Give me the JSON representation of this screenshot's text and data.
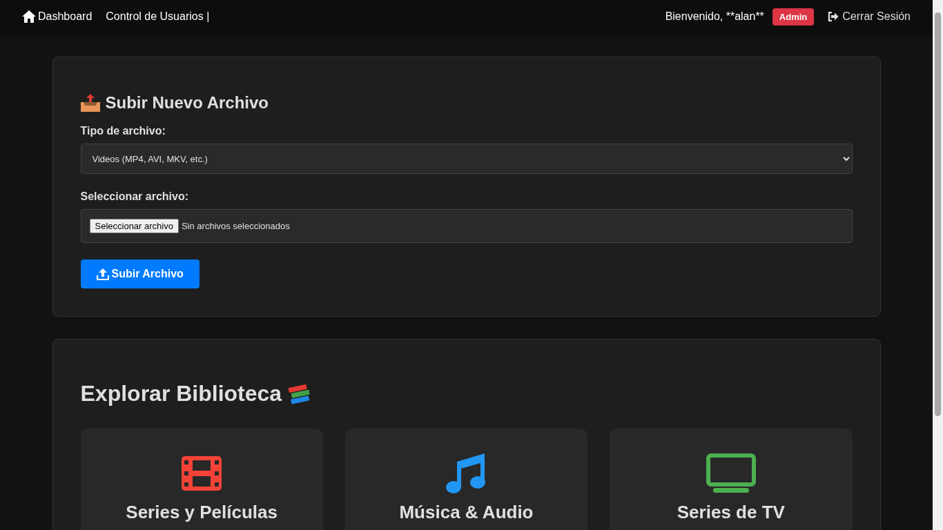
{
  "navbar": {
    "links": [
      {
        "label": "Dashboard",
        "kind": "home"
      },
      {
        "label": "Control de Usuarios |",
        "kind": "plain"
      }
    ],
    "welcome": "Bienvenido, **alan**",
    "role_badge": "Admin",
    "logout": "Cerrar Sesión"
  },
  "upload": {
    "title": "Subir Nuevo Archivo",
    "type_label": "Tipo de archivo:",
    "type_value": "Videos (MP4, AVI, MKV, etc.)",
    "file_label": "Seleccionar archivo:",
    "file_button": "Seleccionar archivo",
    "file_status": "Sin archivos seleccionados",
    "submit": "Subir Archivo"
  },
  "library": {
    "title": "Explorar Biblioteca",
    "categories": [
      {
        "title": "Series y Películas",
        "kind": "film",
        "color": "#f44336"
      },
      {
        "title": "Música & Audio",
        "kind": "music",
        "color": "#2196f3"
      },
      {
        "title": "Series de TV",
        "kind": "tv",
        "color": "#4caf50"
      }
    ]
  }
}
